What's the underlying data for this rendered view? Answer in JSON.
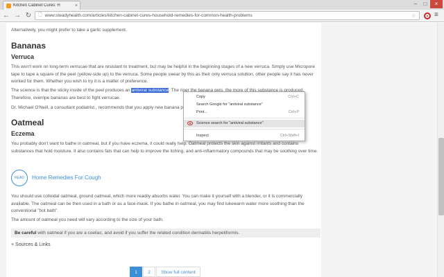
{
  "browser": {
    "tab_title": "Kitchen Cabinet Cures: H",
    "tab_close": "×",
    "url": "www.steadyhealth.com/articles/kitchen-cabinet-cures-household-remedies-for-common-health-problems",
    "controls": {
      "minimize": "–",
      "maximize": "□",
      "close": "×"
    },
    "nav": {
      "back": "←",
      "forward": "→",
      "reload": "↻"
    },
    "star": "☆",
    "menu": "≡"
  },
  "article": {
    "intro": "Alternatively, you might prefer to take a garlic supplement.",
    "bananas_heading": "Bananas",
    "verruca_heading": "Verruca",
    "verruca_p1": "This won't work on long-term verrucae that are resistant to treatment, but may be helpful in the beginning stages of a new verruca. Simply use Micropore tape to tape a square of the peel (yellow-side up) to the verruca. Some people swear by this as their only verruca solution, other people say it has never worked for them. Whether you wish to try it is a matter of preference.",
    "verruca_p2_pre": "The science is that the sticky inside of the peel produces an ",
    "verruca_p2_sel": "antiviral substance",
    "verruca_p2_post": ". The riper the banana gets, the more of this substance is produced. Therefore, overripe bananas are best to fight verrucae.",
    "verruca_p3": "Dr. Michael O'Neill, a consultant podiatrist., recommends that you apply new banana peel every day.",
    "oatmeal_heading": "Oatmeal",
    "eczema_heading": "Eczema",
    "eczema_p1": "You probably don't want to bathe in oatmeal, but if you have eczema, it could really help. Oatmeal protects the skin against irritants and contains substances that hold moisture. It also contains fats that can help to improve the itching, and anti-inflammatory compounds that may be soothing over time.",
    "read_badge": "READ",
    "read_link": "Home Remedies For Cough",
    "eczema_p2": "You should use colloidal oatmeal, ground oatmeal, which more readily absorbs water. You can make it yourself with a blender, or it is commercially available. The oatmeal can be then used in a bath or as a face-mask. If you bathe in oatmeal, you may find lukewarm water more soothing than the conventional \"hot bath\".",
    "eczema_p3": "The amount of oatmeal you need will vary according to the size of your bath.",
    "callout_bold": "Be careful",
    "callout_text": " with oatmeal if you are a coeliac, and avoid if you suffer the related condition dermatitis herpetiformis.",
    "sources": "+ Sources & Links"
  },
  "pagination": {
    "page1": "1",
    "page2": "2",
    "full": "Show full content"
  },
  "context_menu": {
    "copy": "Copy",
    "copy_sc": "Ctrl+C",
    "search": "Search Google for \"antiviral substance\"",
    "print": "Print...",
    "print_sc": "Ctrl+P",
    "science": "Science search for \"antiviral substance\"",
    "inspect": "Inspect",
    "inspect_sc": "Ctrl+Shift+I"
  },
  "colors": {
    "accent": "#3b8fd6",
    "selection": "#3367d6",
    "extension": "#c62828"
  }
}
